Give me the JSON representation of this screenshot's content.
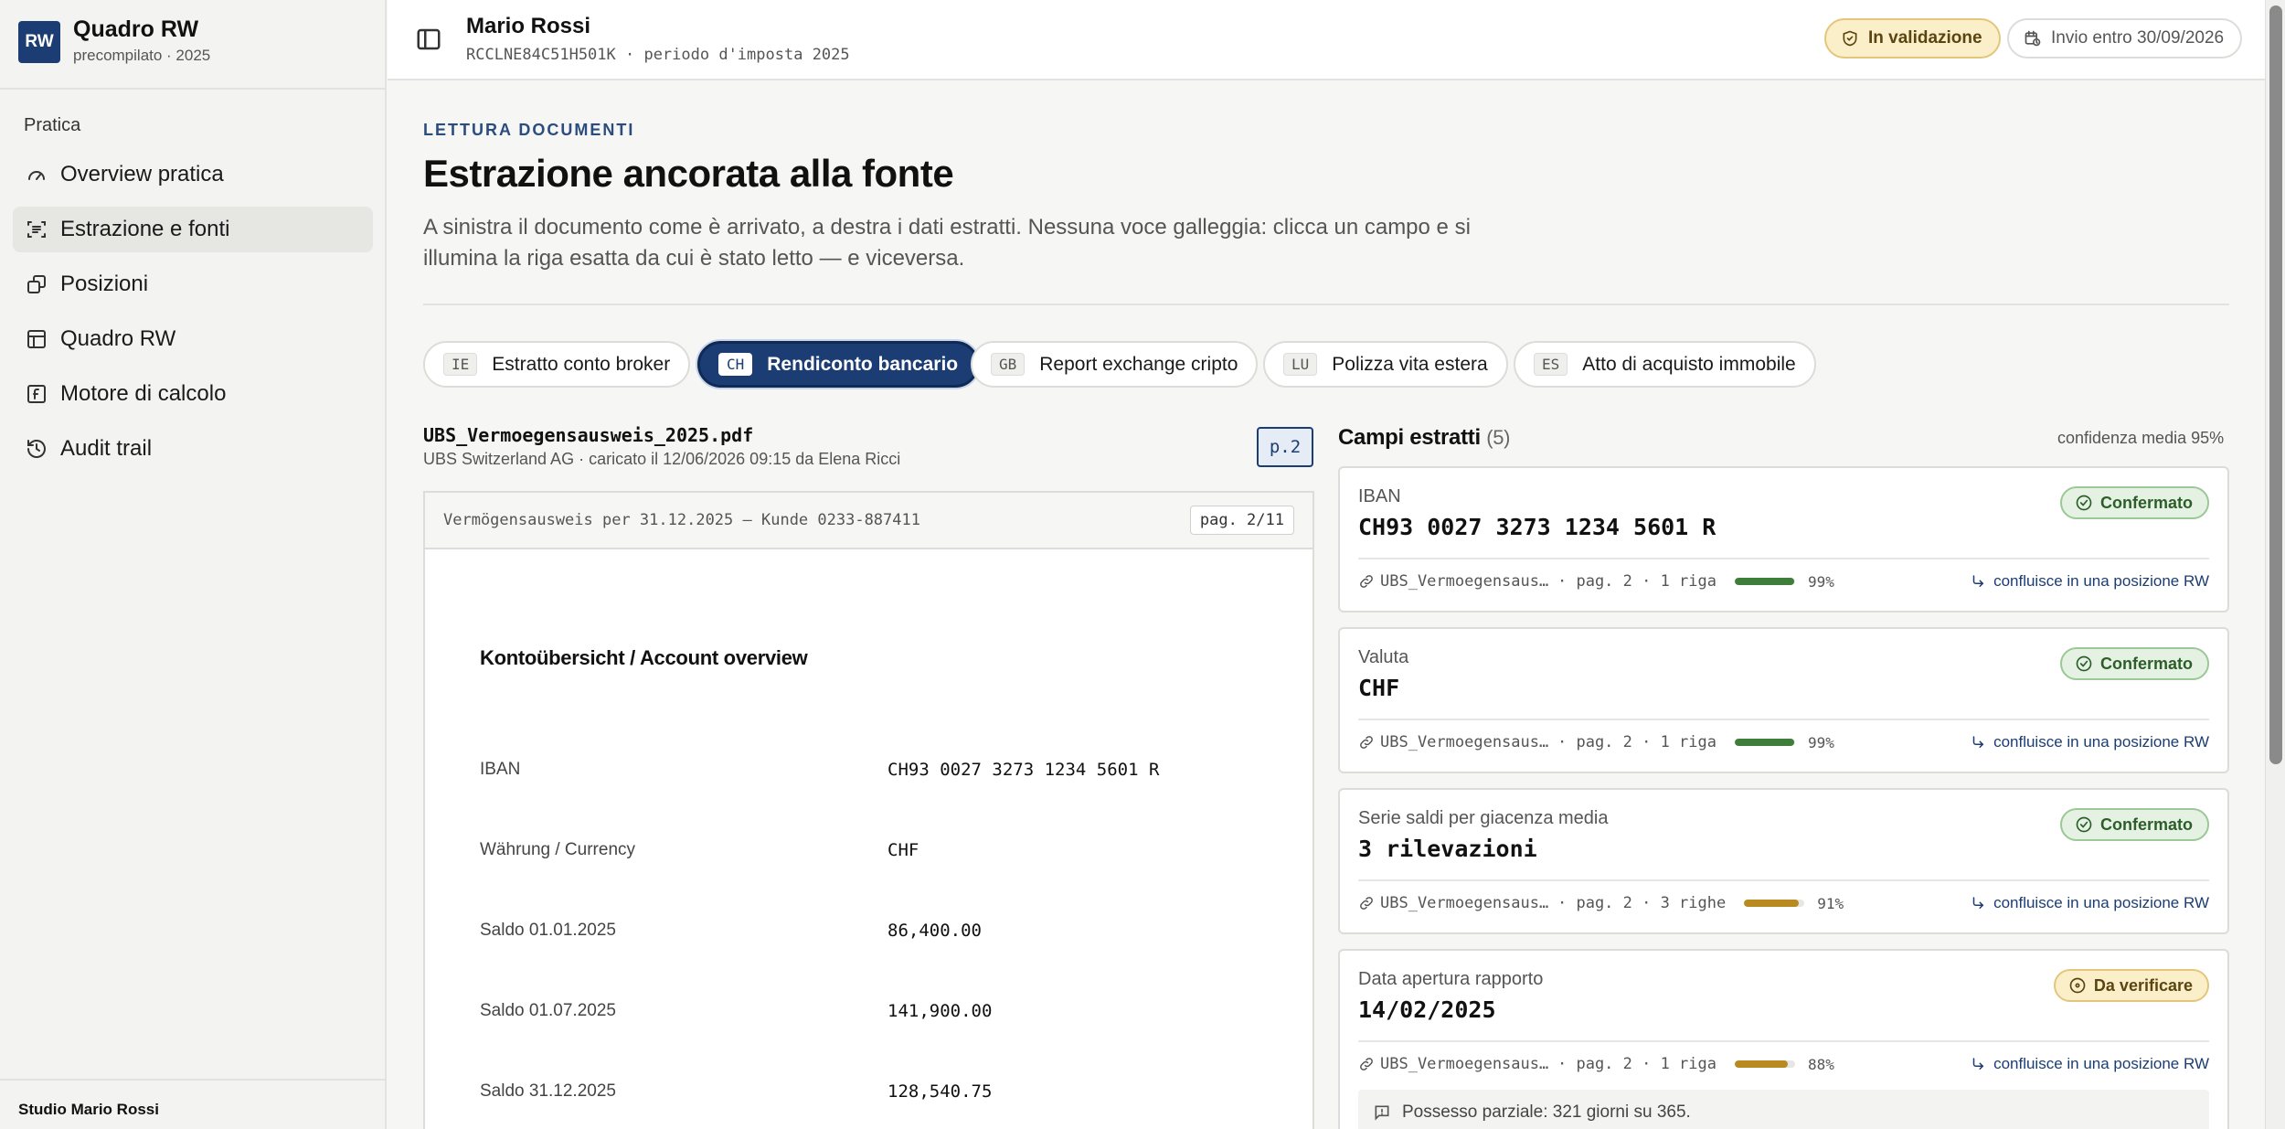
{
  "sidebar": {
    "brand": {
      "logo": "RW",
      "title": "Quadro RW",
      "subtitle": "precompilato · 2025"
    },
    "section_label": "Pratica",
    "items": [
      {
        "label": "Overview pratica",
        "icon": "gauge-icon"
      },
      {
        "label": "Estrazione e fonti",
        "icon": "text-scan-icon",
        "active": true
      },
      {
        "label": "Posizioni",
        "icon": "stack-icon"
      },
      {
        "label": "Quadro RW",
        "icon": "table-icon"
      },
      {
        "label": "Motore di calcolo",
        "icon": "calculator-icon"
      },
      {
        "label": "Audit trail",
        "icon": "history-icon"
      }
    ],
    "footer": {
      "name": "Studio Mario Rossi"
    }
  },
  "topbar": {
    "client_name": "Mario Rossi",
    "client_meta": "RCCLNE84C51H501K · periodo d'imposta 2025",
    "status": "In validazione",
    "deadline": "Invio entro 30/09/2026"
  },
  "main": {
    "kicker": "LETTURA DOCUMENTI",
    "title": "Estrazione ancorata alla fonte",
    "description": "A sinistra il documento come è arrivato, a destra i dati estratti. Nessuna voce galleggia: clicca un campo e si illumina la riga esatta da cui è stato letto — e viceversa.",
    "doc_tabs": [
      {
        "code": "IE",
        "label": "Estratto conto broker"
      },
      {
        "code": "CH",
        "label": "Rendiconto bancario",
        "active": true
      },
      {
        "code": "GB",
        "label": "Report exchange cripto"
      },
      {
        "code": "LU",
        "label": "Polizza vita estera"
      },
      {
        "code": "ES",
        "label": "Atto di acquisto immobile"
      }
    ]
  },
  "document": {
    "filename": "UBS_Vermoegensausweis_2025.pdf",
    "meta": "UBS Switzerland AG · caricato il 12/06/2026 09:15 da Elena Ricci",
    "page_chip": "p.2",
    "header_text": "Vermögensausweis per 31.12.2025 — Kunde 0233-887411",
    "page_indicator": "pag. 2/11",
    "heading": "Kontoübersicht / Account overview",
    "rows": [
      {
        "label": "IBAN",
        "value": "CH93 0027 3273 1234 5601 R"
      },
      {
        "label": "Währung / Currency",
        "value": "CHF"
      },
      {
        "label": "Saldo 01.01.2025",
        "value": "86,400.00"
      },
      {
        "label": "Saldo 01.07.2025",
        "value": "141,900.00"
      },
      {
        "label": "Saldo 31.12.2025",
        "value": "128,540.75"
      }
    ]
  },
  "fields": {
    "title": "Campi estratti",
    "count": "(5)",
    "confidence_label": "confidenza media 95%",
    "flow_label": "confluisce in una posizione RW",
    "items": [
      {
        "label": "IBAN",
        "value": "CH93 0027 3273 1234 5601 R",
        "status": "Confermato",
        "status_kind": "ok",
        "source_file": "UBS_Vermoegensausweis_2025.pdf",
        "source_loc": "· pag. 2 · 1 riga",
        "confidence": 0.99,
        "confidence_label": "99%",
        "bar_color": "#3f7d3a"
      },
      {
        "label": "Valuta",
        "value": "CHF",
        "status": "Confermato",
        "status_kind": "ok",
        "source_file": "UBS_Vermoegensausweis_2025.pdf",
        "source_loc": "· pag. 2 · 1 riga",
        "confidence": 0.99,
        "confidence_label": "99%",
        "bar_color": "#3f7d3a"
      },
      {
        "label": "Serie saldi per giacenza media",
        "value": "3 rilevazioni",
        "status": "Confermato",
        "status_kind": "ok",
        "source_file": "UBS_Vermoegensausweis_2025.pdf",
        "source_loc": "· pag. 2 · 3 righe",
        "confidence": 0.91,
        "confidence_label": "91%",
        "bar_color": "#b88a20"
      },
      {
        "label": "Data apertura rapporto",
        "value": "14/02/2025",
        "status": "Da verificare",
        "status_kind": "warn",
        "source_file": "UBS_Vermoegensausweis_2025.pdf",
        "source_loc": "· pag. 2 · 1 riga",
        "confidence": 0.88,
        "confidence_label": "88%",
        "bar_color": "#b88a20",
        "note": "Possesso parziale: 321 giorni su 365."
      }
    ]
  }
}
